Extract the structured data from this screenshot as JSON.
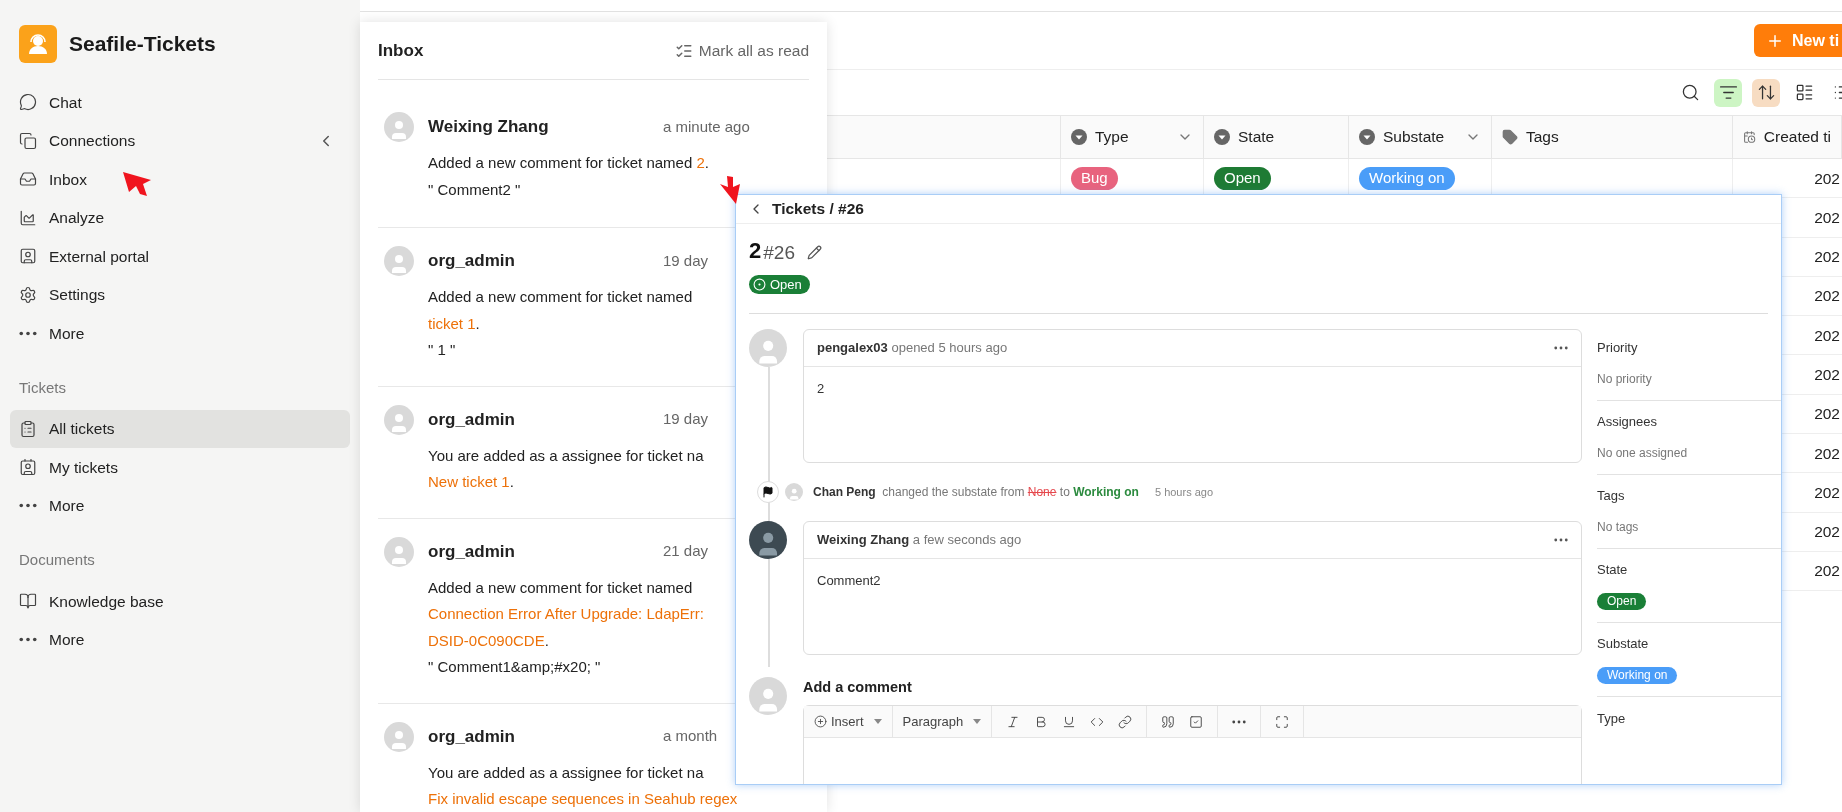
{
  "app": {
    "name": "Seafile-Tickets"
  },
  "sidebar": {
    "nav": [
      {
        "label": "Chat",
        "selected": false,
        "collapsible": false
      },
      {
        "label": "Connections",
        "selected": false,
        "collapsible": true
      },
      {
        "label": "Inbox",
        "selected": false,
        "collapsible": false
      },
      {
        "label": "Analyze",
        "selected": false,
        "collapsible": false
      },
      {
        "label": "External portal",
        "selected": false,
        "collapsible": false
      },
      {
        "label": "Settings",
        "selected": false,
        "collapsible": false
      },
      {
        "label": "More",
        "selected": false,
        "collapsible": false
      }
    ],
    "sections": [
      {
        "title": "Tickets",
        "items": [
          {
            "label": "All tickets",
            "selected": true
          },
          {
            "label": "My tickets",
            "selected": false
          },
          {
            "label": "More",
            "selected": false
          }
        ]
      },
      {
        "title": "Documents",
        "items": [
          {
            "label": "Knowledge base",
            "selected": false
          },
          {
            "label": "More",
            "selected": false
          }
        ]
      }
    ]
  },
  "inbox": {
    "title": "Inbox",
    "action": "Mark all as read",
    "items": [
      {
        "name": "Weixing Zhang",
        "time": "a minute ago",
        "lines": [
          [
            {
              "text": "Added a new comment for ticket named ",
              "link": false
            },
            {
              "text": "2",
              "link": true
            },
            {
              "text": ".",
              "link": false
            }
          ]
        ],
        "quote": "\" Comment2 \""
      },
      {
        "name": "org_admin",
        "time": "19 day",
        "lines": [
          [
            {
              "text": "Added a new comment for ticket named",
              "link": false
            }
          ],
          [
            {
              "text": "ticket 1",
              "link": true
            },
            {
              "text": ".",
              "link": false
            }
          ]
        ],
        "quote": "\" 1 \""
      },
      {
        "name": "org_admin",
        "time": "19 day",
        "lines": [
          [
            {
              "text": "You are added as a assignee for ticket na",
              "link": false
            }
          ],
          [
            {
              "text": "New ticket 1",
              "link": true
            },
            {
              "text": ".",
              "link": false
            }
          ]
        ]
      },
      {
        "name": "org_admin",
        "time": "21 day",
        "lines": [
          [
            {
              "text": "Added a new comment for ticket named",
              "link": false
            }
          ],
          [
            {
              "text": "Connection Error After Upgrade: LdapErr:",
              "link": true
            }
          ],
          [
            {
              "text": "DSID-0C090CDE",
              "link": true
            },
            {
              "text": ".",
              "link": false
            }
          ]
        ],
        "quote": "\" Comment1&amp;#x20; \""
      },
      {
        "name": "org_admin",
        "time": "a month",
        "lines": [
          [
            {
              "text": "You are added as a assignee for ticket na",
              "link": false
            }
          ],
          [
            {
              "text": "Fix invalid escape sequences in Seahub regex",
              "link": true
            }
          ]
        ]
      }
    ]
  },
  "main": {
    "new_button": "New ti",
    "toolbar": [
      {
        "selected": false
      },
      {
        "selected": true,
        "color": "#cdf5c4"
      },
      {
        "selected": true,
        "color": "#f7dcc2"
      },
      {
        "selected": false
      },
      {
        "selected": false
      }
    ],
    "columns": [
      {
        "label": "Type",
        "dropdown": true
      },
      {
        "label": "State",
        "dropdown": false
      },
      {
        "label": "Substate",
        "dropdown": true
      },
      {
        "label": "Tags",
        "dropdown": false
      },
      {
        "label": "Created ti",
        "dropdown": false
      }
    ],
    "rows": [
      {
        "type": {
          "text": "Bug",
          "color": "#e8637e"
        },
        "state": {
          "text": "Open",
          "color": "#1e7b34"
        },
        "substate": {
          "text": "Working on",
          "color": "#4a9df8"
        },
        "created": "202"
      },
      {
        "created": "202"
      },
      {
        "created": "202"
      },
      {
        "created": "202"
      },
      {
        "created": "202"
      },
      {
        "created": "202"
      },
      {
        "created": "202"
      },
      {
        "created": "202"
      },
      {
        "created": "202"
      },
      {
        "created": "202"
      },
      {
        "created": "202"
      }
    ]
  },
  "ticket": {
    "breadcrumb": "Tickets / #26",
    "title": "2",
    "number": "#26",
    "status": {
      "text": "Open",
      "color": "#1a7f37"
    },
    "timeline": [
      {
        "kind": "comment",
        "author": "pengalex03",
        "action": "opened 5 hours ago",
        "body": "2"
      },
      {
        "kind": "event",
        "author": "Chan Peng",
        "text": "changed the substate from",
        "from": "None",
        "joiner": "to",
        "to": "Working on",
        "time": "5 hours ago"
      },
      {
        "kind": "comment",
        "author": "Weixing Zhang",
        "action": "a few seconds ago",
        "body": "Comment2"
      }
    ],
    "composer": {
      "title": "Add a comment",
      "toolbar": [
        [
          {
            "kind": "menu",
            "label": "Insert"
          }
        ],
        [
          {
            "kind": "menu",
            "label": "Paragraph"
          }
        ],
        [
          {
            "kind": "icon"
          },
          {
            "kind": "icon"
          },
          {
            "kind": "icon"
          },
          {
            "kind": "icon"
          },
          {
            "kind": "icon"
          }
        ],
        [
          {
            "kind": "icon"
          },
          {
            "kind": "icon"
          }
        ],
        [
          {
            "kind": "icon"
          }
        ],
        [
          {
            "kind": "icon"
          }
        ]
      ]
    },
    "properties": [
      {
        "label": "Priority",
        "kind": "text",
        "value": "No priority"
      },
      {
        "label": "Assignees",
        "kind": "text",
        "value": "No one assigned"
      },
      {
        "label": "Tags",
        "kind": "text",
        "value": "No tags"
      },
      {
        "label": "State",
        "kind": "badge",
        "value": "Open",
        "color": "#1a7f37"
      },
      {
        "label": "Substate",
        "kind": "badge",
        "value": "Working on",
        "color": "#4a9df8"
      },
      {
        "label": "Type",
        "kind": "label"
      }
    ]
  }
}
